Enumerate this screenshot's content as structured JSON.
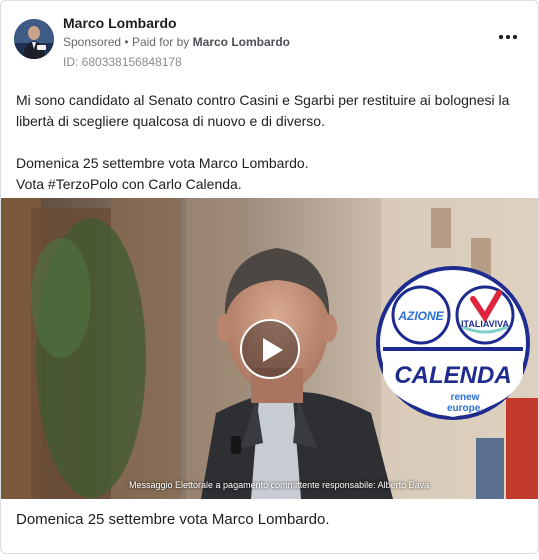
{
  "post": {
    "page_name": "Marco Lombardo",
    "sponsored": "Sponsored",
    "paid_for_by_prefix": "Paid for by",
    "paid_for_by_name": "Marco Lombardo",
    "ad_id": "ID: 680338156848178",
    "body_lines": [
      "Mi sono candidato al Senato contro Casini e Sgarbi per restituire ai bolognesi la",
      "libertà di scegliere qualcosa di nuovo e di diverso.",
      "Domenica 25 settembre vota Marco Lombardo.",
      "Vota #TerzoPolo con Carlo Calenda."
    ]
  },
  "media": {
    "overlay_caption": "Messaggio Elettorale a pagamento committente responsabile: Alberto Bava",
    "logo_azione": "AZIONE",
    "logo_italiaviva": "ITALIAVIVA",
    "logo_calenda": "CALENDA",
    "logo_renew_1": "renew",
    "logo_renew_2": "europe.",
    "colors": {
      "logo_blue": "#1f2c8f",
      "logo_red": "#e0243c",
      "azione_blue": "#2b6fd6"
    }
  },
  "footer": {
    "caption": "Domenica 25 settembre vota Marco Lombardo."
  },
  "icons": {
    "more": "more-options-icon",
    "play": "play-icon"
  }
}
